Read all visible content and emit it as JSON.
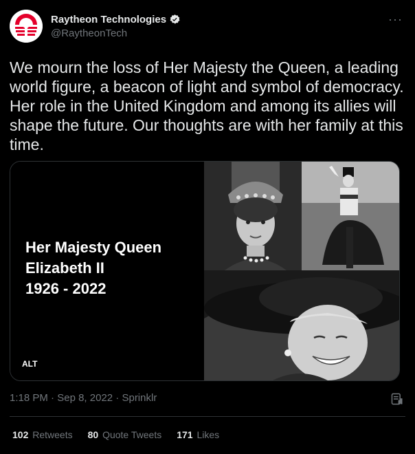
{
  "author": {
    "display_name": "Raytheon Technologies",
    "handle": "@RaytheonTech"
  },
  "tweet": {
    "text": "We mourn the loss of Her Majesty the Queen, a leading world figure, a beacon of light and symbol of democracy. Her role in the United Kingdom and among its allies will shape the future. Our thoughts are with her family at this time."
  },
  "media": {
    "title_line1": "Her Majesty Queen",
    "title_line2": "Elizabeth II",
    "title_line3": "1926 - 2022",
    "alt_label": "ALT"
  },
  "meta": {
    "time": "1:18 PM",
    "date": "Sep 8, 2022",
    "source": "Sprinklr"
  },
  "stats": {
    "retweets_count": "102",
    "retweets_label": "Retweets",
    "quotes_count": "80",
    "quotes_label": "Quote Tweets",
    "likes_count": "171",
    "likes_label": "Likes"
  },
  "colors": {
    "background": "#000000",
    "text": "#e7e9ea",
    "muted": "#71767b",
    "brand_red": "#e4002b"
  }
}
